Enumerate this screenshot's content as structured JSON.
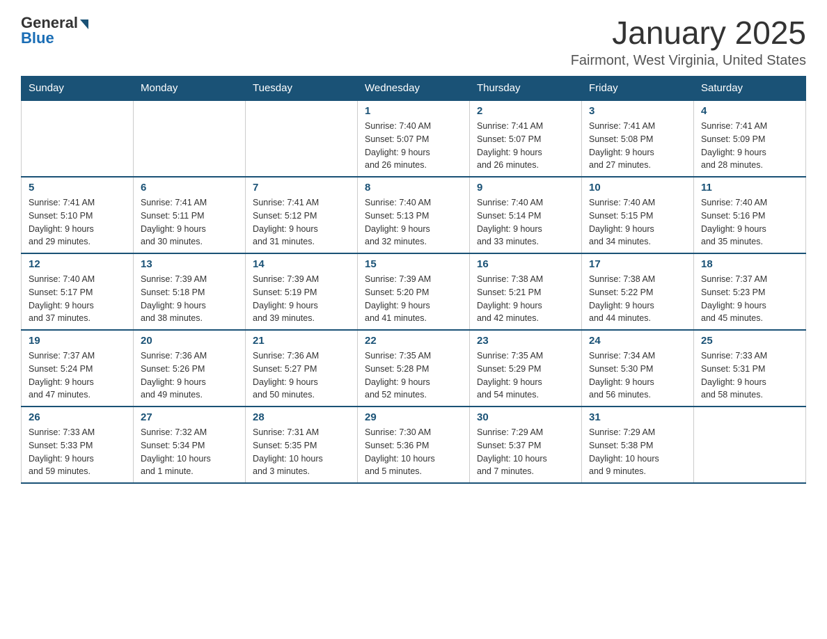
{
  "header": {
    "logo_general": "General",
    "logo_blue": "Blue",
    "title": "January 2025",
    "subtitle": "Fairmont, West Virginia, United States"
  },
  "weekdays": [
    "Sunday",
    "Monday",
    "Tuesday",
    "Wednesday",
    "Thursday",
    "Friday",
    "Saturday"
  ],
  "weeks": [
    [
      {
        "day": "",
        "info": ""
      },
      {
        "day": "",
        "info": ""
      },
      {
        "day": "",
        "info": ""
      },
      {
        "day": "1",
        "info": "Sunrise: 7:40 AM\nSunset: 5:07 PM\nDaylight: 9 hours\nand 26 minutes."
      },
      {
        "day": "2",
        "info": "Sunrise: 7:41 AM\nSunset: 5:07 PM\nDaylight: 9 hours\nand 26 minutes."
      },
      {
        "day": "3",
        "info": "Sunrise: 7:41 AM\nSunset: 5:08 PM\nDaylight: 9 hours\nand 27 minutes."
      },
      {
        "day": "4",
        "info": "Sunrise: 7:41 AM\nSunset: 5:09 PM\nDaylight: 9 hours\nand 28 minutes."
      }
    ],
    [
      {
        "day": "5",
        "info": "Sunrise: 7:41 AM\nSunset: 5:10 PM\nDaylight: 9 hours\nand 29 minutes."
      },
      {
        "day": "6",
        "info": "Sunrise: 7:41 AM\nSunset: 5:11 PM\nDaylight: 9 hours\nand 30 minutes."
      },
      {
        "day": "7",
        "info": "Sunrise: 7:41 AM\nSunset: 5:12 PM\nDaylight: 9 hours\nand 31 minutes."
      },
      {
        "day": "8",
        "info": "Sunrise: 7:40 AM\nSunset: 5:13 PM\nDaylight: 9 hours\nand 32 minutes."
      },
      {
        "day": "9",
        "info": "Sunrise: 7:40 AM\nSunset: 5:14 PM\nDaylight: 9 hours\nand 33 minutes."
      },
      {
        "day": "10",
        "info": "Sunrise: 7:40 AM\nSunset: 5:15 PM\nDaylight: 9 hours\nand 34 minutes."
      },
      {
        "day": "11",
        "info": "Sunrise: 7:40 AM\nSunset: 5:16 PM\nDaylight: 9 hours\nand 35 minutes."
      }
    ],
    [
      {
        "day": "12",
        "info": "Sunrise: 7:40 AM\nSunset: 5:17 PM\nDaylight: 9 hours\nand 37 minutes."
      },
      {
        "day": "13",
        "info": "Sunrise: 7:39 AM\nSunset: 5:18 PM\nDaylight: 9 hours\nand 38 minutes."
      },
      {
        "day": "14",
        "info": "Sunrise: 7:39 AM\nSunset: 5:19 PM\nDaylight: 9 hours\nand 39 minutes."
      },
      {
        "day": "15",
        "info": "Sunrise: 7:39 AM\nSunset: 5:20 PM\nDaylight: 9 hours\nand 41 minutes."
      },
      {
        "day": "16",
        "info": "Sunrise: 7:38 AM\nSunset: 5:21 PM\nDaylight: 9 hours\nand 42 minutes."
      },
      {
        "day": "17",
        "info": "Sunrise: 7:38 AM\nSunset: 5:22 PM\nDaylight: 9 hours\nand 44 minutes."
      },
      {
        "day": "18",
        "info": "Sunrise: 7:37 AM\nSunset: 5:23 PM\nDaylight: 9 hours\nand 45 minutes."
      }
    ],
    [
      {
        "day": "19",
        "info": "Sunrise: 7:37 AM\nSunset: 5:24 PM\nDaylight: 9 hours\nand 47 minutes."
      },
      {
        "day": "20",
        "info": "Sunrise: 7:36 AM\nSunset: 5:26 PM\nDaylight: 9 hours\nand 49 minutes."
      },
      {
        "day": "21",
        "info": "Sunrise: 7:36 AM\nSunset: 5:27 PM\nDaylight: 9 hours\nand 50 minutes."
      },
      {
        "day": "22",
        "info": "Sunrise: 7:35 AM\nSunset: 5:28 PM\nDaylight: 9 hours\nand 52 minutes."
      },
      {
        "day": "23",
        "info": "Sunrise: 7:35 AM\nSunset: 5:29 PM\nDaylight: 9 hours\nand 54 minutes."
      },
      {
        "day": "24",
        "info": "Sunrise: 7:34 AM\nSunset: 5:30 PM\nDaylight: 9 hours\nand 56 minutes."
      },
      {
        "day": "25",
        "info": "Sunrise: 7:33 AM\nSunset: 5:31 PM\nDaylight: 9 hours\nand 58 minutes."
      }
    ],
    [
      {
        "day": "26",
        "info": "Sunrise: 7:33 AM\nSunset: 5:33 PM\nDaylight: 9 hours\nand 59 minutes."
      },
      {
        "day": "27",
        "info": "Sunrise: 7:32 AM\nSunset: 5:34 PM\nDaylight: 10 hours\nand 1 minute."
      },
      {
        "day": "28",
        "info": "Sunrise: 7:31 AM\nSunset: 5:35 PM\nDaylight: 10 hours\nand 3 minutes."
      },
      {
        "day": "29",
        "info": "Sunrise: 7:30 AM\nSunset: 5:36 PM\nDaylight: 10 hours\nand 5 minutes."
      },
      {
        "day": "30",
        "info": "Sunrise: 7:29 AM\nSunset: 5:37 PM\nDaylight: 10 hours\nand 7 minutes."
      },
      {
        "day": "31",
        "info": "Sunrise: 7:29 AM\nSunset: 5:38 PM\nDaylight: 10 hours\nand 9 minutes."
      },
      {
        "day": "",
        "info": ""
      }
    ]
  ]
}
